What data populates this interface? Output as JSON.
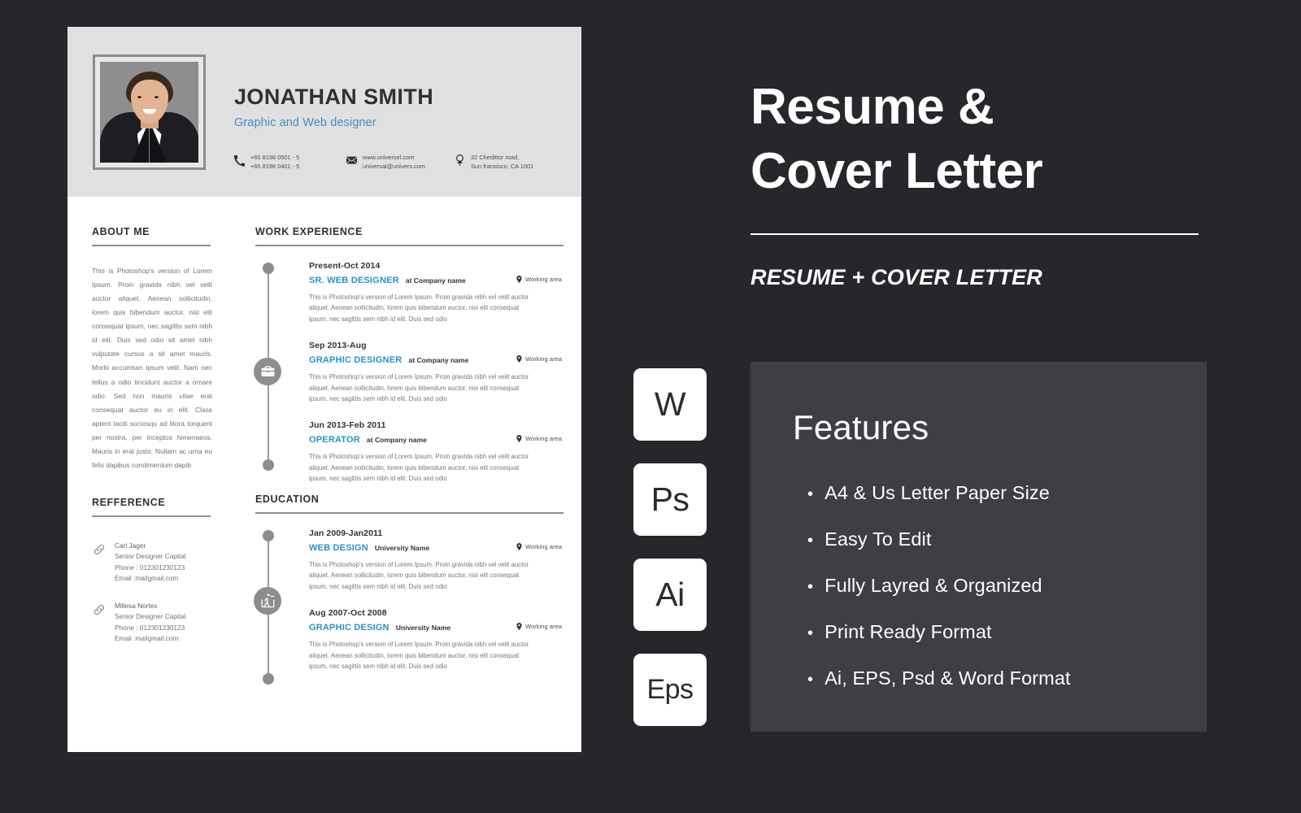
{
  "colors": {
    "page_background": "#26262b",
    "panel_background": "#3e3e44",
    "resume_header": "#e0e0e0",
    "accent_blue": "#2b8fcc",
    "dark_text": "#2d3138",
    "muted_text": "#73787f"
  },
  "resume": {
    "profile": {
      "name": "JONATHAN SMITH",
      "job_title": "Graphic and Web designer",
      "photo_alt": "portrait-photo"
    },
    "contacts": [
      {
        "icon": "phone-icon",
        "line1": "+65 8198 0501 - 5",
        "line2": "+65 8198 0401 - 5"
      },
      {
        "icon": "envelope-icon",
        "line1": "www.universel.com",
        "line2": "universal@univers.com"
      },
      {
        "icon": "location-pin-icon",
        "line1": "32 Chedittor road,",
        "line2": "Sun fransisco, CA 1001"
      }
    ],
    "about": {
      "heading": "ABOUT ME",
      "text": "This is Photoshop's version of Lorem Ipsum. Proin gravida nibh vel velit auctor aliquet. Aenean sollicitudin, lorem quis bibendum auctor, nisi elit consequat ipsum, nec sagittis sem nibh id elit. Duis sed odio sit amet nibh vulputate cursus a sit amet mauris. Morbi accumsan ipsum velit. Nam nec tellus a odio tincidunt auctor a ornare odio. Sed non  mauris vitae erat consequat auctor eu in elit. Class aptent taciti sociosqu ad litora torquent per nostra, per inceptos himenaeos. Mauris in erat justo. Nullam ac urna eu felis dapibus condimentum dapib"
    },
    "reference": {
      "heading": "REFFERENCE",
      "items": [
        {
          "icon": "link-icon",
          "name": "Carl Jager",
          "role": "Senior Designer Capital",
          "phone": "Phone : 012301230123",
          "email": "Email :mailgmail.com"
        },
        {
          "icon": "link-icon",
          "name": "Millesa Nortex",
          "role": "Senior Designer Capital",
          "phone": "Phone : 012301230123",
          "email": "Email :mailgmail.com"
        }
      ]
    },
    "work": {
      "heading": "WORK EXPERIENCE",
      "badge_icon": "briefcase-icon",
      "entries": [
        {
          "date": "Present-Oct 2014",
          "role": "SR. WEB DESIGNER",
          "company": "at Company name",
          "area": "Working area",
          "desc": "This is Photoshop's version of Lorem Ipsum. Proin gravida nibh vel velit auctor aliquet. Aenean sollicitudin, lorem quis bibendum auctor, nisi elit consequat ipsum, nec sagittis sem nibh id elit. Duis sed odio"
        },
        {
          "date": "Sep 2013-Aug",
          "role": "GRAPHIC DESIGNER",
          "company": "at Company name",
          "area": "Working area",
          "desc": "This is Photoshop's version of Lorem Ipsum. Proin gravida nibh vel velit auctor aliquet. Aenean sollicitudin, lorem quis bibendum auctor, nisi elit consequat ipsum, nec sagittis sem nibh id elit. Duis sed odio"
        },
        {
          "date": "Jun 2013-Feb 2011",
          "role": "OPERATOR",
          "company": "at Company name",
          "area": "Working area",
          "desc": "This is Photoshop's version of Lorem Ipsum. Proin gravida nibh vel velit auctor aliquet. Aenean sollicitudin, lorem quis bibendum auctor, nisi elit consequat ipsum, nec sagittis sem nibh id elit. Duis sed odio"
        }
      ]
    },
    "education": {
      "heading": "EDUCATION",
      "badge_icon": "teacher-presentation-icon",
      "entries": [
        {
          "date": "Jan 2009-Jan2011",
          "role": "WEB DESIGN",
          "company": "University Name",
          "area": "Working area",
          "desc": "This is Photoshop's version of Lorem Ipsum. Proin gravida nibh vel velit auctor aliquet. Aenean sollicitudin, lorem quis bibendum auctor, nisi elit consequat ipsum, nec sagittis sem nibh id elit. Duis sed odio"
        },
        {
          "date": "Aug 2007-Oct 2008",
          "role": "GRAPHIC DESIGN",
          "company": "University Name",
          "area": "Working area",
          "desc": "This is Photoshop's version of Lorem Ipsum. Proin gravida nibh vel velit auctor aliquet. Aenean sollicitudin, lorem quis bibendum auctor, nisi elit consequat ipsum, nec sagittis sem nibh id elit. Duis sed odio"
        }
      ]
    }
  },
  "promo": {
    "title_line1": "Resume &",
    "title_line2": "Cover  Letter",
    "subtitle": "RESUME + COVER LETTER",
    "format_badges": [
      "W",
      "Ps",
      "Ai",
      "Eps"
    ],
    "features": {
      "title": "Features",
      "bullet": "•",
      "items": [
        "A4  & Us Letter Paper Size",
        "Easy To Edit",
        "Fully Layred & Organized",
        "Print Ready Format",
        "Ai, EPS, Psd & Word Format"
      ]
    }
  }
}
